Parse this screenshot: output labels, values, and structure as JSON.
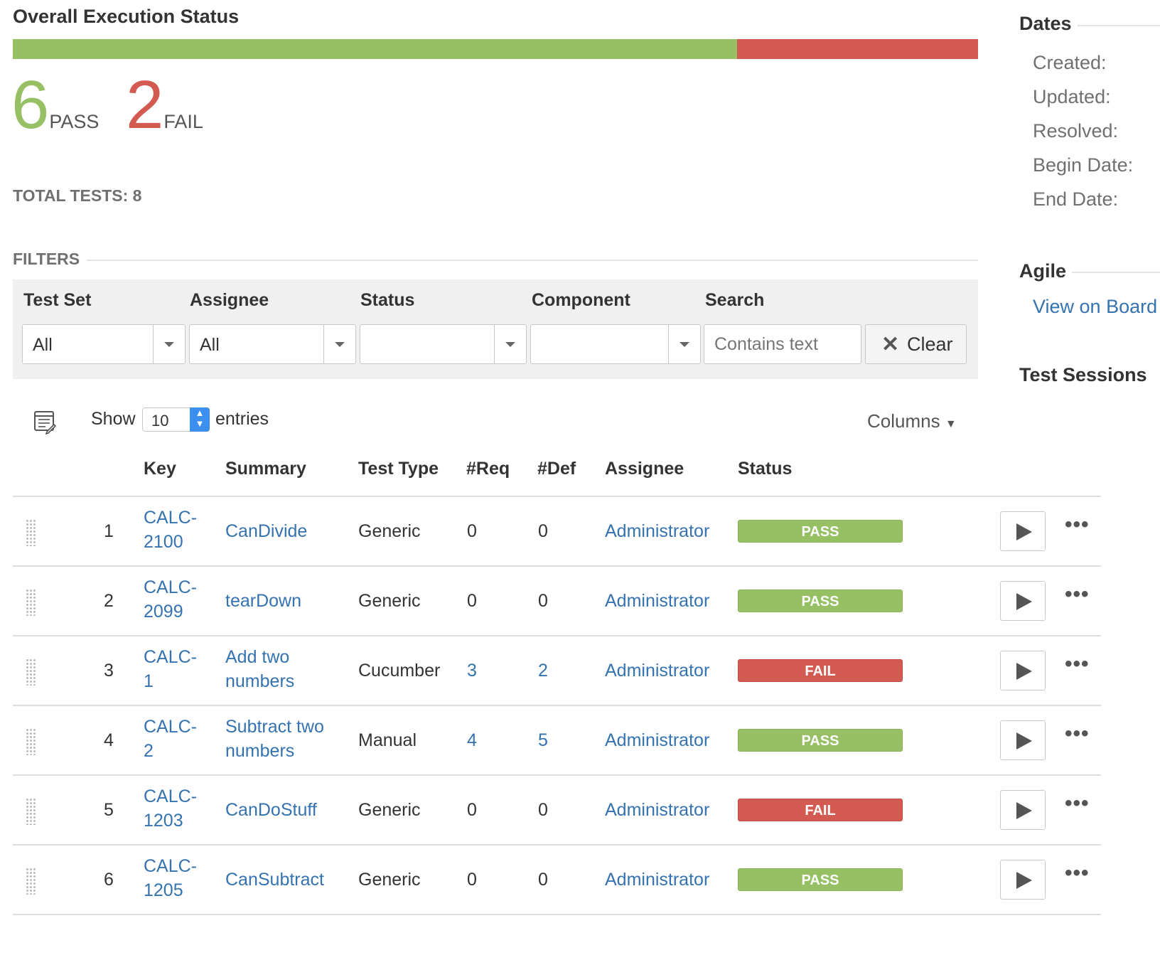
{
  "header": {
    "title": "Overall Execution Status"
  },
  "progress": {
    "pass_fraction": 0.75,
    "pass_color": "#97c065",
    "fail_color": "#d35a50"
  },
  "summary": {
    "pass_count": "6",
    "pass_label": "PASS",
    "fail_count": "2",
    "fail_label": "FAIL",
    "total": "TOTAL TESTS: 8"
  },
  "filters": {
    "heading": "FILTERS",
    "test_set_label": "Test Set",
    "test_set_value": "All",
    "assignee_label": "Assignee",
    "assignee_value": "All",
    "status_label": "Status",
    "status_value": "",
    "component_label": "Component",
    "component_value": "",
    "search_label": "Search",
    "search_placeholder": "Contains text",
    "clear_label": "Clear"
  },
  "table_controls": {
    "show_label": "Show",
    "entries_value": "10",
    "entries_label": "entries",
    "columns_label": "Columns"
  },
  "table": {
    "headers": [
      "Key",
      "Summary",
      "Test Type",
      "#Req",
      "#Def",
      "Assignee",
      "Status"
    ],
    "rows": [
      {
        "num": "1",
        "key1": "CALC-",
        "key2": "2100",
        "sum1": "CanDivide",
        "sum2": "",
        "type": "Generic",
        "req": "0",
        "def": "0",
        "assignee": "Administrator",
        "status": "PASS"
      },
      {
        "num": "2",
        "key1": "CALC-",
        "key2": "2099",
        "sum1": "tearDown",
        "sum2": "",
        "type": "Generic",
        "req": "0",
        "def": "0",
        "assignee": "Administrator",
        "status": "PASS"
      },
      {
        "num": "3",
        "key1": "CALC-",
        "key2": "1",
        "sum1": "Add two",
        "sum2": "numbers",
        "type": "Cucumber",
        "req": "3",
        "def": "2",
        "assignee": "Administrator",
        "status": "FAIL"
      },
      {
        "num": "4",
        "key1": "CALC-",
        "key2": "2",
        "sum1": "Subtract two",
        "sum2": "numbers",
        "type": "Manual",
        "req": "4",
        "def": "5",
        "assignee": "Administrator",
        "status": "PASS"
      },
      {
        "num": "5",
        "key1": "CALC-",
        "key2": "1203",
        "sum1": "CanDoStuff",
        "sum2": "",
        "type": "Generic",
        "req": "0",
        "def": "0",
        "assignee": "Administrator",
        "status": "FAIL"
      },
      {
        "num": "6",
        "key1": "CALC-",
        "key2": "1205",
        "sum1": "CanSubtract",
        "sum2": "",
        "type": "Generic",
        "req": "0",
        "def": "0",
        "assignee": "Administrator",
        "status": "PASS"
      }
    ]
  },
  "sidebar": {
    "dates_heading": "Dates",
    "dates": [
      "Created:",
      "Updated:",
      "Resolved:",
      "Begin Date:",
      "End Date:"
    ],
    "agile_heading": "Agile",
    "agile_link": "View on Board",
    "sessions_heading": "Test Sessions"
  },
  "icons": {
    "table_settings": "list-edit-icon",
    "drag": "drag-handle-icon",
    "play": "play-icon",
    "more": "ellipsis-icon",
    "clear": "close-icon",
    "dropdown": "caret-down-icon"
  }
}
